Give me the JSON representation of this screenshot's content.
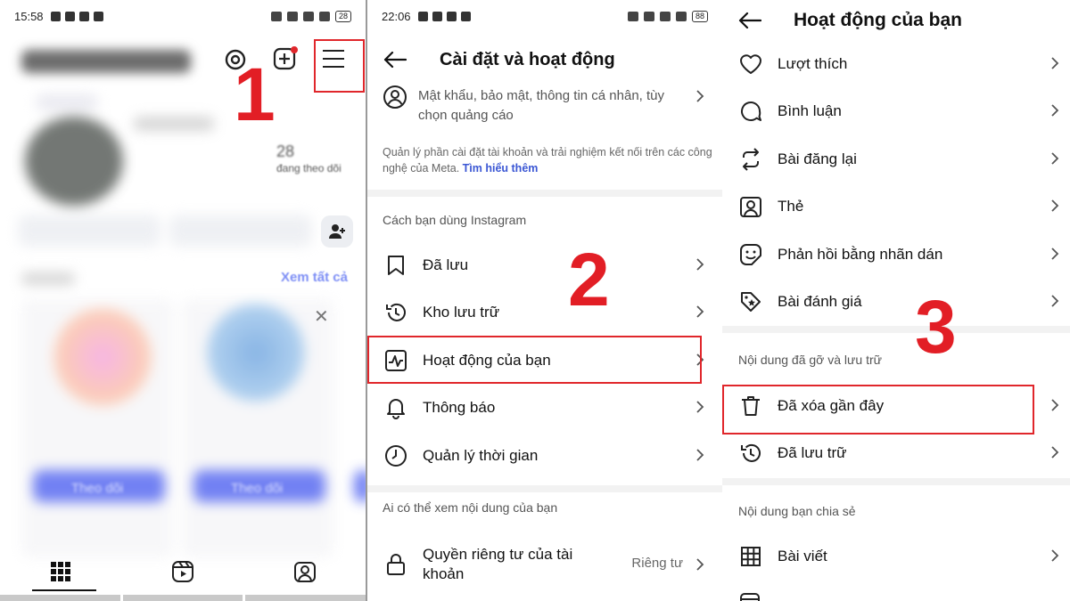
{
  "panel1": {
    "status": {
      "time": "15:58",
      "battery": "28"
    },
    "step": "1",
    "blurred_link": "Xem tất cả",
    "blurred_stat": "28",
    "blurred_stat_label": "đang theo dõi",
    "follow_label": "Theo dõi"
  },
  "panel2": {
    "status": {
      "time": "22:06",
      "battery": "88"
    },
    "title": "Cài đặt và hoạt động",
    "account_text": "Mật khẩu, bảo mật, thông tin cá nhân, tùy chọn quảng cáo",
    "meta_note": "Quản lý phần cài đặt tài khoản và trải nghiệm kết nối trên các công nghệ của Meta.",
    "meta_link": "Tìm hiểu thêm",
    "section_usage": "Cách bạn dùng Instagram",
    "items": [
      {
        "label": "Đã lưu",
        "icon": "bookmark-icon"
      },
      {
        "label": "Kho lưu trữ",
        "icon": "archive-icon"
      },
      {
        "label": "Hoạt động của bạn",
        "icon": "activity-icon"
      },
      {
        "label": "Thông báo",
        "icon": "bell-icon"
      },
      {
        "label": "Quản lý thời gian",
        "icon": "clock-icon"
      }
    ],
    "step": "2",
    "section_visibility": "Ai có thể xem nội dung của bạn",
    "privacy_label": "Quyền riêng tư của tài khoản",
    "privacy_value": "Riêng tư"
  },
  "panel3": {
    "title": "Hoạt động của bạn",
    "items": [
      {
        "label": "Lượt thích",
        "icon": "heart-icon"
      },
      {
        "label": "Bình luận",
        "icon": "comment-icon"
      },
      {
        "label": "Bài đăng lại",
        "icon": "repost-icon"
      },
      {
        "label": "Thẻ",
        "icon": "tag-person-icon"
      },
      {
        "label": "Phản hồi bằng nhãn dán",
        "icon": "sticker-icon"
      },
      {
        "label": "Bài đánh giá",
        "icon": "review-icon"
      }
    ],
    "step": "3",
    "section_removed": "Nội dung đã gỡ và lưu trữ",
    "removed_items": [
      {
        "label": "Đã xóa gần đây",
        "icon": "trash-icon"
      },
      {
        "label": "Đã lưu trữ",
        "icon": "archive-icon"
      }
    ],
    "section_shared": "Nội dung bạn chia sẻ",
    "shared_items": [
      {
        "label": "Bài viết",
        "icon": "grid-icon"
      }
    ]
  },
  "colors": {
    "highlight": "#e0262b",
    "step": "#e21e25",
    "link": "#3b57d4"
  }
}
